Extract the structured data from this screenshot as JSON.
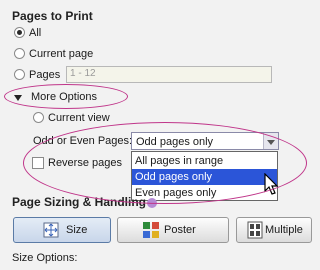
{
  "pages_to_print": {
    "heading": "Pages to Print",
    "options": [
      {
        "label": "All",
        "selected": true
      },
      {
        "label": "Current page",
        "selected": false
      },
      {
        "label": "Pages",
        "selected": false
      }
    ],
    "pages_range_placeholder": "1 - 12"
  },
  "more_options": {
    "label": "More Options",
    "current_view_label": "Current view",
    "odd_even_label": "Odd or Even Pages:",
    "odd_even_value": "Odd pages only",
    "odd_even_options": [
      {
        "label": "All pages in range",
        "selected": false
      },
      {
        "label": "Odd pages only",
        "selected": true
      },
      {
        "label": "Even pages only",
        "selected": false
      }
    ],
    "reverse_pages_label": "Reverse pages"
  },
  "page_sizing": {
    "heading": "Page Sizing & Handling",
    "buttons": [
      {
        "label": "Size",
        "active": true
      },
      {
        "label": "Poster",
        "active": false
      },
      {
        "label": "Multiple",
        "active": false
      }
    ],
    "size_options_label": "Size Options:"
  },
  "colors": {
    "highlight": "#2b55d8",
    "annotation": "#c0368a"
  }
}
